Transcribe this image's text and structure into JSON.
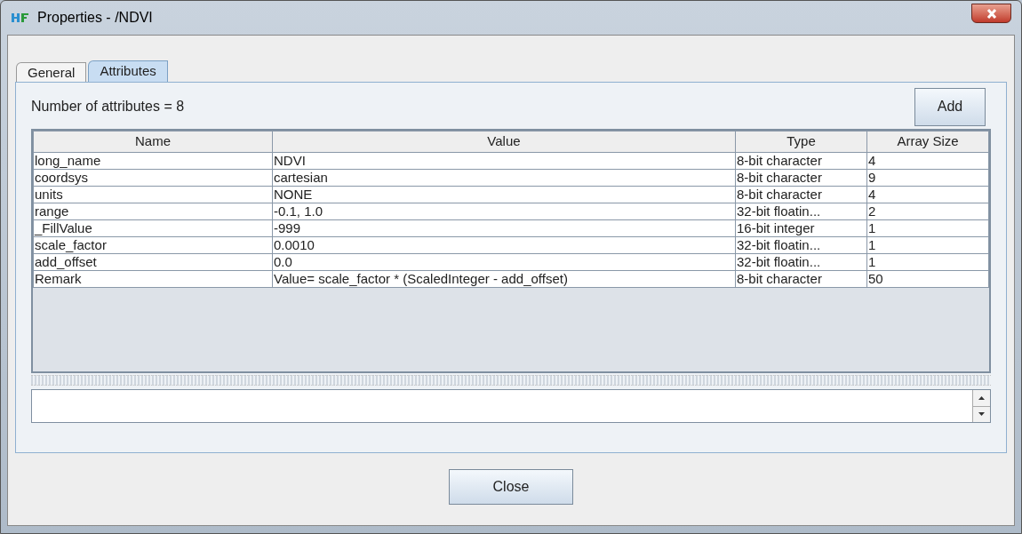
{
  "window": {
    "title": "Properties - /NDVI"
  },
  "tabs": [
    {
      "label": "General",
      "selected": false
    },
    {
      "label": "Attributes",
      "selected": true
    }
  ],
  "attribute_count": "Number of attributes = 8",
  "add_button": "Add",
  "table": {
    "columns": [
      "Name",
      "Value",
      "Type",
      "Array Size"
    ],
    "rows": [
      [
        "long_name",
        "NDVI",
        "8-bit character",
        "4"
      ],
      [
        "coordsys",
        "cartesian",
        "8-bit character",
        "9"
      ],
      [
        "units",
        "NONE",
        "8-bit character",
        "4"
      ],
      [
        "range",
        "-0.1, 1.0",
        "32-bit floatin...",
        "2"
      ],
      [
        "_FillValue",
        "-999",
        "16-bit integer",
        "1"
      ],
      [
        "scale_factor",
        "0.0010",
        "32-bit floatin...",
        "1"
      ],
      [
        "add_offset",
        "0.0",
        "32-bit floatin...",
        "1"
      ],
      [
        "Remark",
        "Value= scale_factor * (ScaledInteger - add_offset)",
        "8-bit character",
        "50"
      ]
    ]
  },
  "close_button": "Close"
}
